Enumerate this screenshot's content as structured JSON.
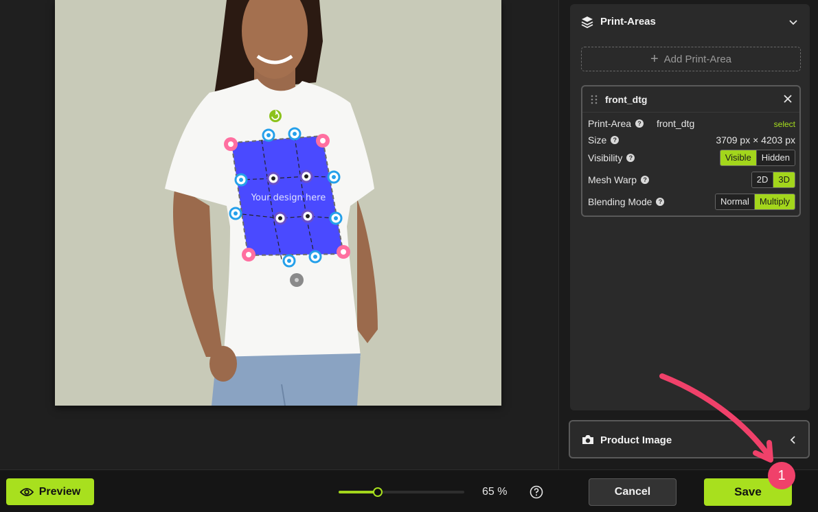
{
  "canvas": {
    "design_placeholder": "Your design here"
  },
  "print_areas": {
    "title": "Print-Areas",
    "add_label": "Add Print-Area",
    "card": {
      "name": "front_dtg",
      "print_area_label": "Print-Area",
      "print_area_value": "front_dtg",
      "select_label": "select",
      "size_label": "Size",
      "size_value": "3709 px × 4203 px",
      "visibility_label": "Visibility",
      "visibility_options": [
        "Visible",
        "Hidden"
      ],
      "visibility_selected": "Visible",
      "mesh_warp_label": "Mesh Warp",
      "mesh_warp_options": [
        "2D",
        "3D"
      ],
      "mesh_warp_selected": "3D",
      "blending_label": "Blending Mode",
      "blending_options": [
        "Normal",
        "Multiply"
      ],
      "blending_selected": "Multiply"
    }
  },
  "product_image": {
    "title": "Product Image"
  },
  "toolbar": {
    "preview_label": "Preview",
    "zoom_label": "65 %",
    "zoom_fraction": 0.31,
    "cancel_label": "Cancel",
    "save_label": "Save"
  },
  "annotation": {
    "step_number": "1"
  },
  "colors": {
    "accent": "#a8e01e",
    "badge": "#f0416a",
    "panel": "#2a2a2a",
    "print_area_fill": "#4a4aff"
  },
  "icons": [
    "layers-icon",
    "chevron-down-icon",
    "plus-icon",
    "drag-handle-icon",
    "close-icon",
    "help-icon",
    "camera-icon",
    "chevron-left-icon",
    "eye-icon",
    "rotate-handle-icon",
    "move-handle-icon"
  ]
}
